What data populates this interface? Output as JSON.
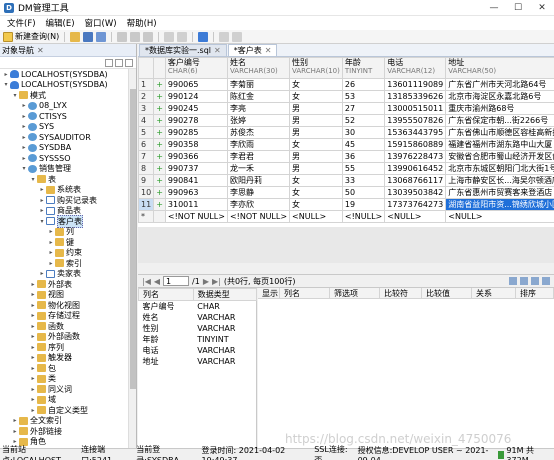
{
  "window": {
    "title": "DM管理工具",
    "min": "—",
    "max": "☐",
    "close": "✕"
  },
  "menu": [
    "文件(F)",
    "编辑(E)",
    "窗口(W)",
    "帮助(H)"
  ],
  "toolbar": {
    "new_query": "新建查询(N)"
  },
  "left_panel": {
    "title": "对象导航",
    "tree": [
      {
        "indent": 0,
        "tw": "›",
        "icon": "db",
        "label": "LOCALHOST(SYSDBA)"
      },
      {
        "indent": 0,
        "tw": "⌄",
        "icon": "db",
        "label": "LOCALHOST(SYSDBA)"
      },
      {
        "indent": 1,
        "tw": "⌄",
        "icon": "folder",
        "label": "模式"
      },
      {
        "indent": 2,
        "tw": "›",
        "icon": "user",
        "label": "08_LYX"
      },
      {
        "indent": 2,
        "tw": "›",
        "icon": "user",
        "label": "CTISYS"
      },
      {
        "indent": 2,
        "tw": "›",
        "icon": "user",
        "label": "SYS"
      },
      {
        "indent": 2,
        "tw": "›",
        "icon": "user",
        "label": "SYSAUDITOR"
      },
      {
        "indent": 2,
        "tw": "›",
        "icon": "user",
        "label": "SYSDBA"
      },
      {
        "indent": 2,
        "tw": "›",
        "icon": "user",
        "label": "SYSSSO"
      },
      {
        "indent": 2,
        "tw": "⌄",
        "icon": "user",
        "label": "销售管理"
      },
      {
        "indent": 3,
        "tw": "⌄",
        "icon": "folder",
        "label": "表"
      },
      {
        "indent": 4,
        "tw": "›",
        "icon": "folder",
        "label": "系统表"
      },
      {
        "indent": 4,
        "tw": "›",
        "icon": "table",
        "label": "购买记录表"
      },
      {
        "indent": 4,
        "tw": "›",
        "icon": "table",
        "label": "商品表"
      },
      {
        "indent": 4,
        "tw": "⌄",
        "icon": "table",
        "label": "客户表",
        "selected": true
      },
      {
        "indent": 5,
        "tw": "›",
        "icon": "folder",
        "label": "列"
      },
      {
        "indent": 5,
        "tw": "›",
        "icon": "folder",
        "label": "键"
      },
      {
        "indent": 5,
        "tw": "›",
        "icon": "folder",
        "label": "约束"
      },
      {
        "indent": 5,
        "tw": "›",
        "icon": "folder",
        "label": "索引"
      },
      {
        "indent": 4,
        "tw": "›",
        "icon": "table",
        "label": "卖家表"
      },
      {
        "indent": 3,
        "tw": "›",
        "icon": "folder",
        "label": "外部表"
      },
      {
        "indent": 3,
        "tw": "›",
        "icon": "folder",
        "label": "视图"
      },
      {
        "indent": 3,
        "tw": "›",
        "icon": "folder",
        "label": "物化视图"
      },
      {
        "indent": 3,
        "tw": "›",
        "icon": "folder",
        "label": "存储过程"
      },
      {
        "indent": 3,
        "tw": "›",
        "icon": "folder",
        "label": "函数"
      },
      {
        "indent": 3,
        "tw": "›",
        "icon": "folder",
        "label": "外部函数"
      },
      {
        "indent": 3,
        "tw": "›",
        "icon": "folder",
        "label": "序列"
      },
      {
        "indent": 3,
        "tw": "›",
        "icon": "folder",
        "label": "触发器"
      },
      {
        "indent": 3,
        "tw": "›",
        "icon": "folder",
        "label": "包"
      },
      {
        "indent": 3,
        "tw": "›",
        "icon": "folder",
        "label": "类"
      },
      {
        "indent": 3,
        "tw": "›",
        "icon": "folder",
        "label": "同义词"
      },
      {
        "indent": 3,
        "tw": "›",
        "icon": "folder",
        "label": "域"
      },
      {
        "indent": 3,
        "tw": "›",
        "icon": "folder",
        "label": "自定义类型"
      },
      {
        "indent": 1,
        "tw": "›",
        "icon": "folder",
        "label": "全文索引"
      },
      {
        "indent": 1,
        "tw": "›",
        "icon": "folder",
        "label": "外部链接"
      },
      {
        "indent": 1,
        "tw": "›",
        "icon": "folder",
        "label": "角色"
      }
    ]
  },
  "tabs": [
    {
      "label": "*数据库实验一.sql",
      "active": false
    },
    {
      "label": "*客户表",
      "active": true
    }
  ],
  "grid": {
    "columns": [
      {
        "name": "客户编号",
        "type": "CHAR(6)"
      },
      {
        "name": "姓名",
        "type": "VARCHAR(30)"
      },
      {
        "name": "性别",
        "type": "VARCHAR(10)"
      },
      {
        "name": "年龄",
        "type": "TINYINT"
      },
      {
        "name": "电话",
        "type": "VARCHAR(12)"
      },
      {
        "name": "地址",
        "type": "VARCHAR(50)"
      }
    ],
    "rows": [
      {
        "n": "1",
        "cells": [
          "990065",
          "李菊丽",
          "女",
          "26",
          "13601119089",
          "广东省广州市天河北路64号"
        ]
      },
      {
        "n": "2",
        "cells": [
          "990124",
          "陈红金",
          "女",
          "53",
          "13185339626",
          "北京市海淀区永嘉北路6号"
        ]
      },
      {
        "n": "3",
        "cells": [
          "990245",
          "李亮",
          "男",
          "27",
          "13000515011",
          "重庆市渝州路68号"
        ]
      },
      {
        "n": "4",
        "cells": [
          "990278",
          "张婷",
          "男",
          "52",
          "13955507826",
          "广东省保定市朝...街2266号"
        ]
      },
      {
        "n": "5",
        "cells": [
          "990285",
          "苏俊杰",
          "男",
          "30",
          "15363443795",
          "广东省佛山市顺德区容桂高新技术"
        ]
      },
      {
        "n": "6",
        "cells": [
          "990358",
          "李欣雨",
          "女",
          "45",
          "15915860889",
          "福建省福州市湖东路中山大厦"
        ]
      },
      {
        "n": "7",
        "cells": [
          "990366",
          "李君君",
          "男",
          "36",
          "13976228473",
          "安徽省合肥市蜀山经济开发区创"
        ]
      },
      {
        "n": "8",
        "cells": [
          "990737",
          "龙一禾",
          "男",
          "55",
          "13990616452",
          "北京市东城区朝阳门北大街1号"
        ]
      },
      {
        "n": "9",
        "cells": [
          "990841",
          "欧阳丹莉",
          "女",
          "33",
          "13068766117",
          "上海市静安区长...海吴尔顿酒店"
        ]
      },
      {
        "n": "10",
        "cells": [
          "990963",
          "李思静",
          "女",
          "50",
          "13039503842",
          "广东省惠州市贸赛客来登酒店"
        ]
      },
      {
        "n": "11",
        "cells": [
          "310011",
          "李亦欣",
          "女",
          "19",
          "17373764273",
          "湖南省益阳市资...锦绣欣城小区"
        ],
        "selected": true
      }
    ],
    "new_row": [
      "<!NOT NULL>",
      "<!NOT NULL>",
      "<NULL>",
      "<!NULL>",
      "<NULL>",
      "<NULL>"
    ]
  },
  "pager": {
    "page": "1",
    "total": "/1",
    "summary": "(共0行, 每页100行)"
  },
  "column_panel": {
    "headers": [
      "列名",
      "数据类型"
    ],
    "rows": [
      [
        "客户编号",
        "CHAR"
      ],
      [
        "姓名",
        "VARCHAR"
      ],
      [
        "性别",
        "VARCHAR"
      ],
      [
        "年龄",
        "TINYINT"
      ],
      [
        "电话",
        "VARCHAR"
      ],
      [
        "地址",
        "VARCHAR"
      ]
    ]
  },
  "filter_panel": {
    "headers": [
      "显示",
      "列名",
      "筛选项",
      "比较符",
      "比较值",
      "关系",
      "排序"
    ]
  },
  "status": {
    "host": "当前站点:LOCALHOST",
    "port": "连接端口:5241",
    "login": "当前登录:SYSDBA",
    "time": "登录时间: 2021-04-02 19:49:37",
    "ssl": "SSL连接:否",
    "license": "授权信息:DEVELOP USER ~ 2021-09-04",
    "mem": "91M 共 372M"
  },
  "watermark": "https://blog.csdn.net/weixin_4750076"
}
